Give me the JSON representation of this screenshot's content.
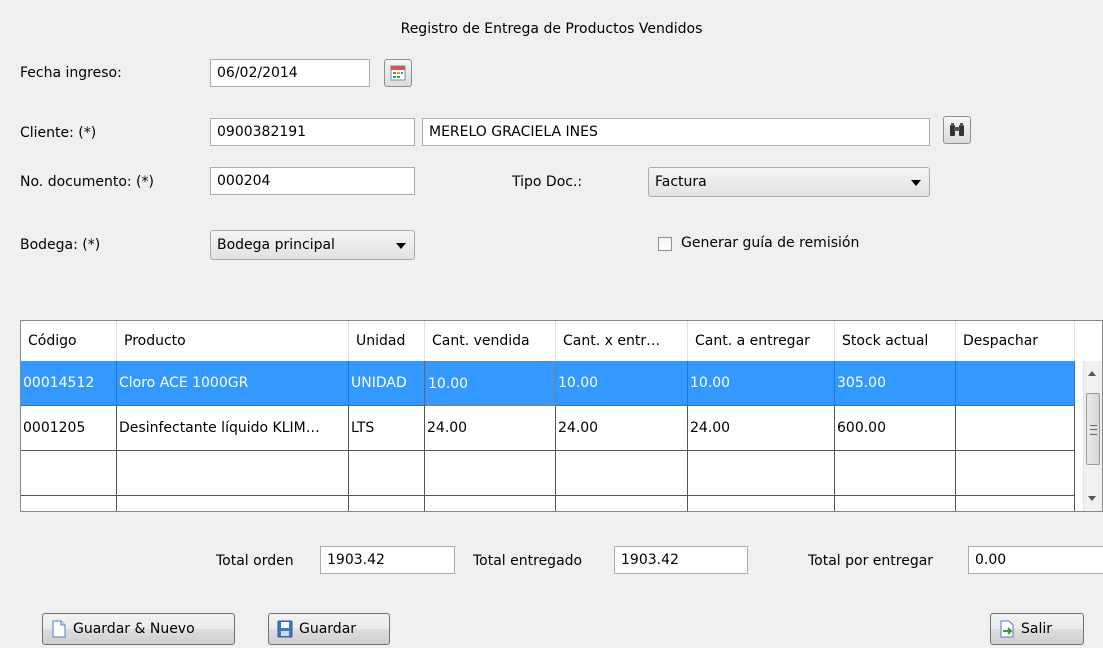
{
  "window": {
    "title": "Registro de Entrega de Productos Vendidos"
  },
  "form": {
    "fecha_label": "Fecha ingreso:",
    "fecha_value": "06/02/2014",
    "cliente_label": "Cliente: (*)",
    "cliente_id": "0900382191",
    "cliente_name": "MERELO GRACIELA INES",
    "documento_label": "No. documento: (*)",
    "documento_value": "000204",
    "tipo_doc_label": "Tipo Doc.:",
    "tipo_doc_value": "Factura",
    "bodega_label": "Bodega: (*)",
    "bodega_value": "Bodega principal",
    "guia_label": "Generar guía de remisión",
    "guia_checked": false
  },
  "table": {
    "columns": [
      "Código",
      "Producto",
      "Unidad",
      "Cant. vendida",
      "Cant. x entr…",
      "Cant. a entregar",
      "Stock actual",
      "Despachar"
    ],
    "rows": [
      {
        "codigo": "00014512",
        "producto": "Cloro ACE 1000GR",
        "unidad": "UNIDAD",
        "vendida": "10.00",
        "x_entregar": "10.00",
        "a_entregar": "10.00",
        "stock": "305.00",
        "despachar": ""
      },
      {
        "codigo": "0001205",
        "producto": "Desinfectante líquido KLIM…",
        "unidad": "LTS",
        "vendida": "24.00",
        "x_entregar": "24.00",
        "a_entregar": "24.00",
        "stock": "600.00",
        "despachar": ""
      }
    ]
  },
  "totals": {
    "orden_label": "Total orden",
    "orden_value": "1903.42",
    "entregado_label": "Total entregado",
    "entregado_value": "1903.42",
    "por_entregar_label": "Total por entregar",
    "por_entregar_value": "0.00"
  },
  "buttons": {
    "guardar_nuevo": "Guardar & Nuevo",
    "guardar": "Guardar",
    "salir": "Salir"
  },
  "icons": {
    "calendar": "calendar-icon",
    "search": "binoculars-icon",
    "new_doc": "new-document-icon",
    "save": "floppy-disk-icon",
    "exit": "exit-icon"
  },
  "colors": {
    "selection": "#3399ff",
    "background": "#f0f0f0"
  }
}
